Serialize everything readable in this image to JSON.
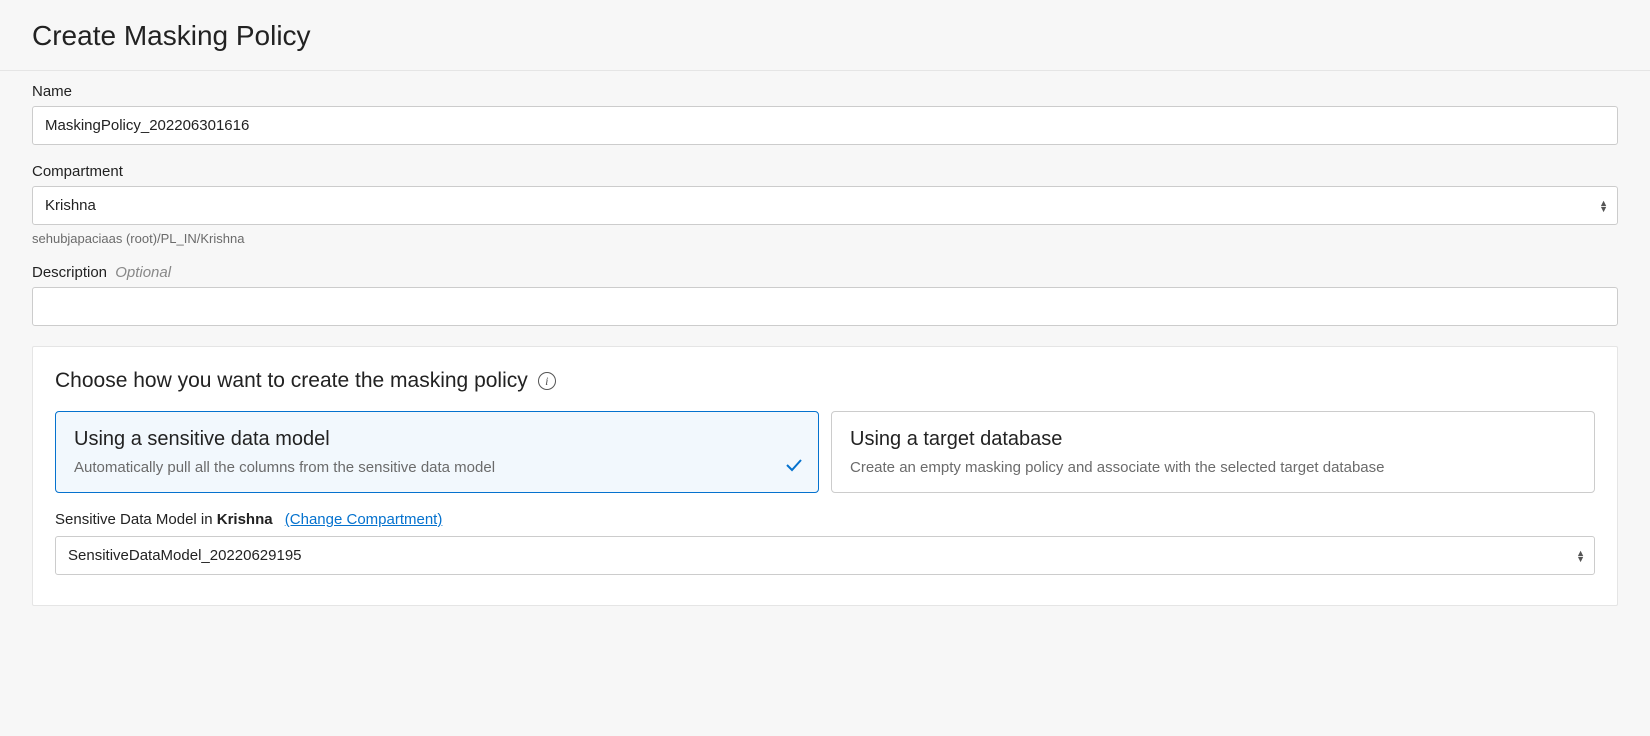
{
  "header": {
    "title": "Create Masking Policy"
  },
  "fields": {
    "name": {
      "label": "Name",
      "value": "MaskingPolicy_202206301616"
    },
    "compartment": {
      "label": "Compartment",
      "value": "Krishna",
      "path": "sehubjapaciaas (root)/PL_IN/Krishna"
    },
    "description": {
      "label": "Description",
      "optional_tag": "Optional",
      "value": ""
    }
  },
  "choose_section": {
    "title": "Choose how you want to create the masking policy",
    "options": {
      "sdm": {
        "title": "Using a sensitive data model",
        "desc": "Automatically pull all the columns from the sensitive data model"
      },
      "target_db": {
        "title": "Using a target database",
        "desc": "Create an empty masking policy and associate with the selected target database"
      }
    },
    "sdm_field": {
      "label_prefix": "Sensitive Data Model in ",
      "compartment": "Krishna",
      "change_link": "(Change Compartment)",
      "value": "SensitiveDataModel_20220629195"
    }
  }
}
